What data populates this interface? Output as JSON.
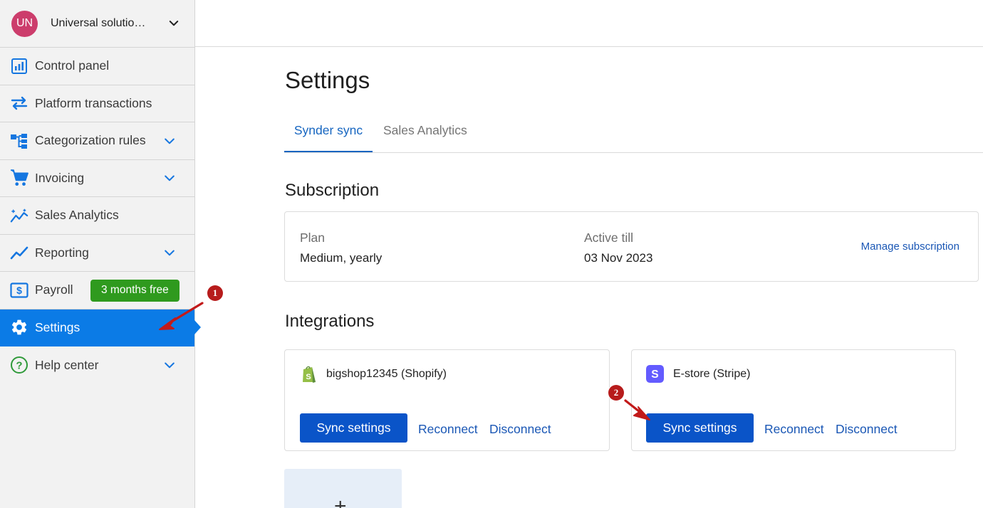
{
  "org": {
    "initials": "UN",
    "name": "Universal solutions inc.",
    "chevron_icon": "chevron-down-icon"
  },
  "sidebar": {
    "items": [
      {
        "label": "Control panel",
        "icon": "dashboard-icon"
      },
      {
        "label": "Platform transactions",
        "icon": "arrows-swap-icon"
      },
      {
        "label": "Categorization rules",
        "icon": "hierarchy-icon"
      },
      {
        "label": "Invoicing",
        "icon": "cart-icon"
      },
      {
        "label": "Sales Analytics",
        "icon": "sparkle-chart-icon"
      },
      {
        "label": "Reporting",
        "icon": "trend-line-icon"
      },
      {
        "label": "Payroll",
        "icon": "dollar-card-icon",
        "badge": "3 months free"
      },
      {
        "label": "Settings",
        "icon": "gear-icon",
        "active": true
      },
      {
        "label": "Help center",
        "icon": "help-circle-icon"
      }
    ]
  },
  "page": {
    "title": "Settings"
  },
  "tabs": [
    {
      "label": "Synder sync",
      "active": true
    },
    {
      "label": "Sales Analytics"
    }
  ],
  "subscription": {
    "section_title": "Subscription",
    "plan_label": "Plan",
    "plan_value": "Medium, yearly",
    "active_label": "Active till",
    "active_value": "03 Nov 2023",
    "manage_link": "Manage subscription"
  },
  "integrations": {
    "section_title": "Integrations",
    "cards": [
      {
        "name": "bigshop12345 (Shopify)",
        "logo": "shopify-logo-icon",
        "sync_label": "Sync settings",
        "reconnect_label": "Reconnect",
        "disconnect_label": "Disconnect"
      },
      {
        "name": "E-store (Stripe)",
        "logo": "stripe-logo-icon",
        "sync_label": "Sync settings",
        "reconnect_label": "Reconnect",
        "disconnect_label": "Disconnect"
      }
    ],
    "add_symbol": "+"
  },
  "annotations": {
    "marker1": "1",
    "marker2": "2"
  },
  "colors": {
    "accent": "#0b7be6",
    "primary_button": "#0a54c8",
    "badge": "#2f9a1e",
    "avatar": "#cc3d6c",
    "marker": "#b71c1c"
  }
}
